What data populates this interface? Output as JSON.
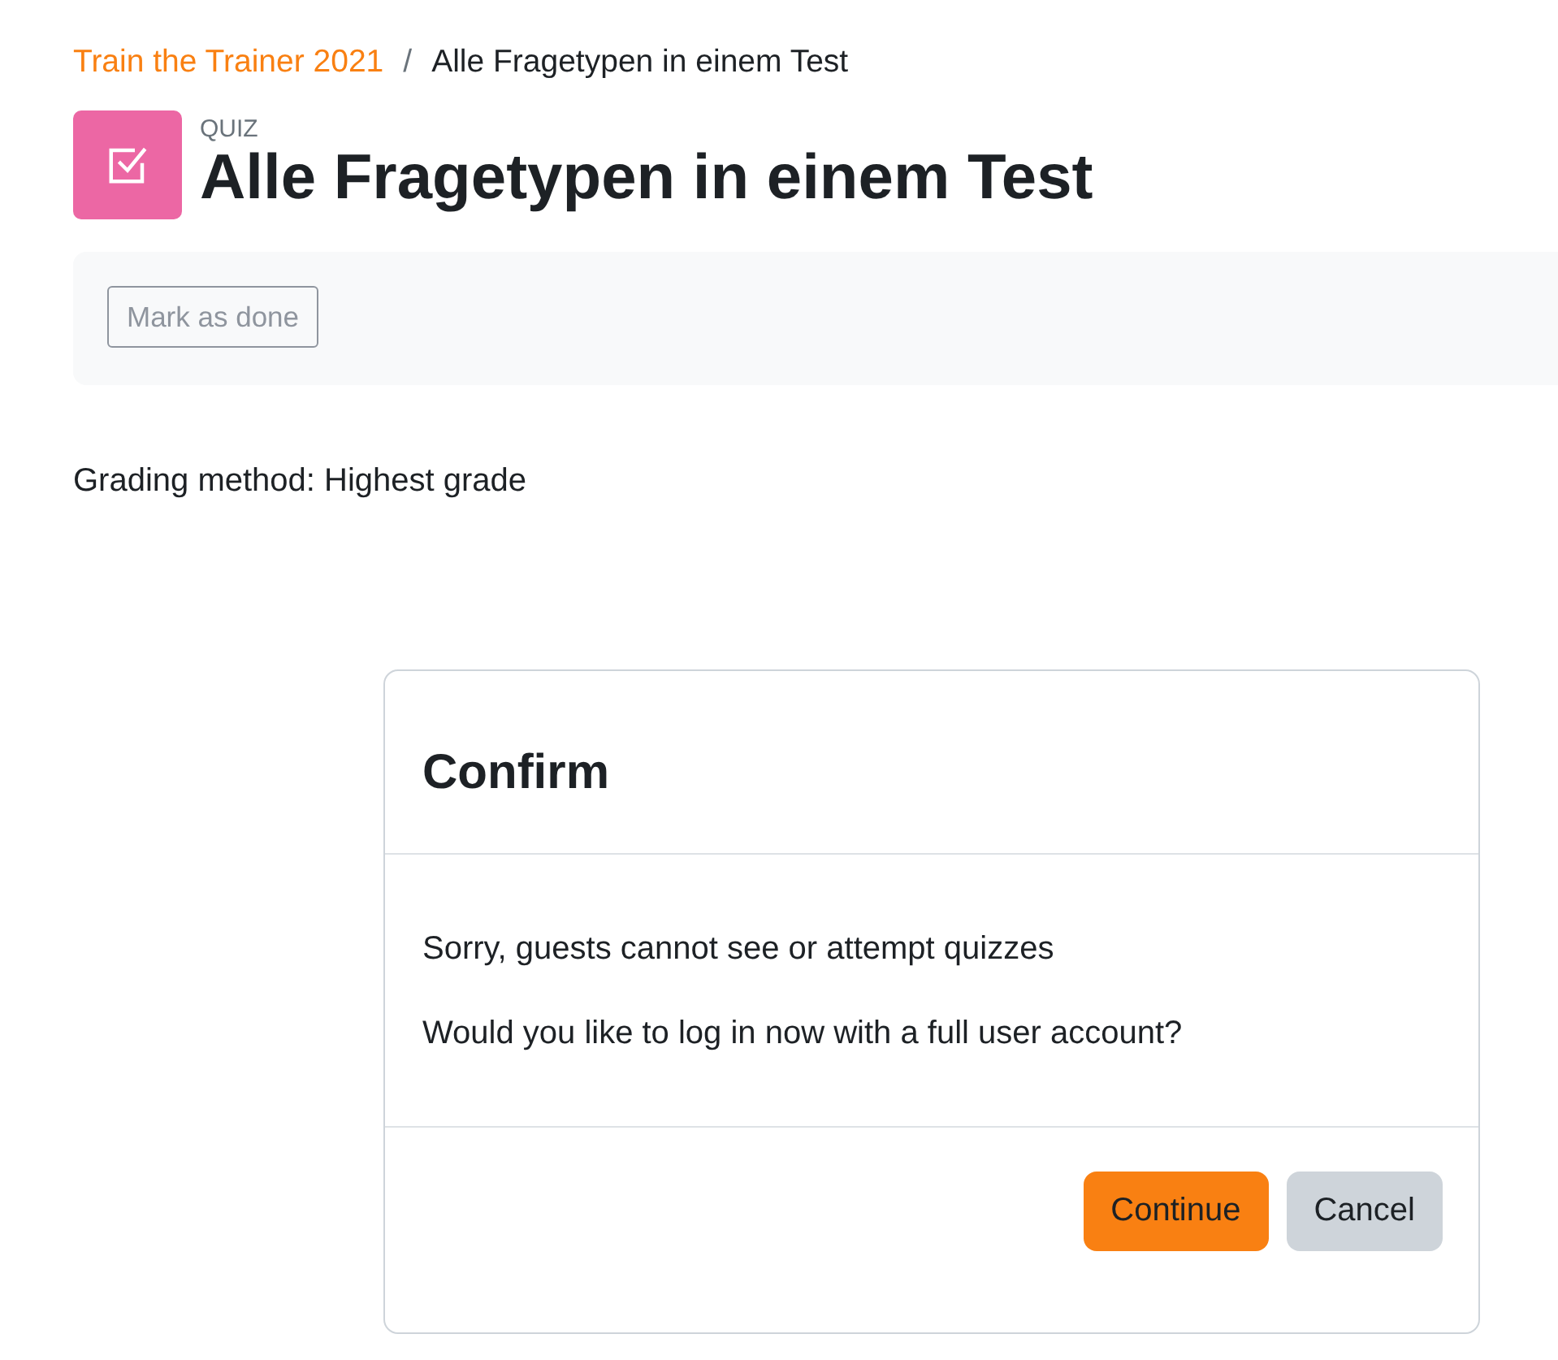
{
  "breadcrumb": {
    "items": [
      {
        "label": "Train the Trainer 2021",
        "kind": "link"
      },
      {
        "label": "Alle Fragetypen in einem Test",
        "kind": "current"
      }
    ],
    "separator": "/"
  },
  "header": {
    "type_label": "QUIZ",
    "title": "Alle Fragetypen in einem Test"
  },
  "completion": {
    "button": "Mark as done"
  },
  "info": [
    "Grading method: Highest grade"
  ],
  "dialog": {
    "title": "Confirm",
    "messages": [
      "Sorry, guests cannot see or attempt quizzes",
      "Would you like to log in now with a full user account?"
    ],
    "buttons": [
      {
        "label": "Continue",
        "kind": "primary"
      },
      {
        "label": "Cancel",
        "kind": "secondary"
      }
    ]
  }
}
